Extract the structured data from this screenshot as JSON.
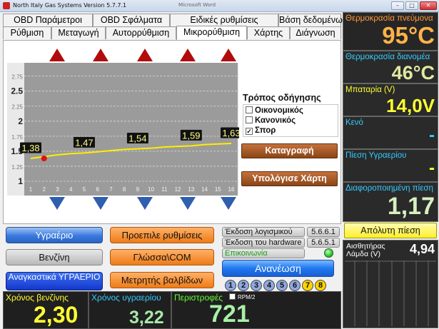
{
  "titlebar": {
    "title": "North Italy Gas Systems    Version    5.7.7.1",
    "inner_title": "Microsoft Word",
    "minimize": "–",
    "maximize": "□",
    "close": "✕"
  },
  "tabs_row1": [
    {
      "label": "OBD Παράμετροι"
    },
    {
      "label": "OBD Σφάλματα"
    },
    {
      "label": "Ειδικές ρυθμίσεις"
    },
    {
      "label": "Βάση δεδομένων"
    }
  ],
  "tabs_row2": [
    {
      "label": "Ρύθμιση"
    },
    {
      "label": "Μεταγωγή"
    },
    {
      "label": "Αυτορρύθμιση"
    },
    {
      "label": "Μικρορύθμιση"
    },
    {
      "label": "Χάρτης"
    },
    {
      "label": "Διάγνωση"
    }
  ],
  "chart_data": {
    "type": "line",
    "x": [
      1,
      2,
      3,
      4,
      5,
      6,
      7,
      8,
      9,
      10,
      11,
      12,
      13,
      14,
      15,
      16
    ],
    "y_ticks": [
      "2.75",
      "2.5",
      "2.25",
      "2",
      "1.75",
      "1.5",
      "1.25",
      "1"
    ],
    "ylim": [
      1,
      2.9
    ],
    "series": [
      {
        "values": [
          1.38,
          1.41,
          1.44,
          1.46,
          1.47,
          1.49,
          1.51,
          1.53,
          1.54,
          1.55,
          1.57,
          1.58,
          1.59,
          1.61,
          1.62,
          1.63
        ]
      }
    ],
    "data_labels": [
      {
        "x": 1,
        "text": "1,38"
      },
      {
        "x": 5,
        "text": "1,47"
      },
      {
        "x": 9,
        "text": "1,54"
      },
      {
        "x": 13,
        "text": "1,59"
      },
      {
        "x": 16,
        "text": "1,63"
      }
    ],
    "marker": {
      "x": 2,
      "y": 1.38
    },
    "line_color": "#ffee00",
    "grid": true
  },
  "drive_mode": {
    "legend": "Τρόπος οδήγησης",
    "options": [
      {
        "label": "Οικονομικός",
        "checked": false
      },
      {
        "label": "Κανονικός",
        "checked": false
      },
      {
        "label": "Σπορ",
        "checked": true
      }
    ]
  },
  "buttons": {
    "record": "Καταγραφή",
    "calc_map": "Υπολόγισε Χάρτη",
    "lpg": "Υγραέριο",
    "petrol": "Βενζίνη",
    "forced_lpg": "Αναγκαστικά ΥΓΡΑΕΡΙΟ",
    "preset": "Προεπιλε ρυθμίσεις",
    "language_com": "Γλώσσα\\COM",
    "valve_counter": "Μετρητής βαλβίδων",
    "refresh": "Ανανέωση"
  },
  "info": {
    "software_label": "Έκδοση λογισμικού",
    "software_value": "5.6.6.1",
    "hardware_label": "Έκδοση του hardware",
    "hardware_value": "5.6.5.1",
    "comm_label": "Επικοινωνία",
    "comm_color": "#33cc33"
  },
  "cylinders": [
    "1",
    "2",
    "3",
    "4",
    "5",
    "6",
    "7",
    "8"
  ],
  "counters": {
    "petrol_time_label": "Χρόνος βενζίνης",
    "petrol_time": "2,30",
    "lpg_time_label": "Χρόνος υγραερίου",
    "lpg_time": "3,22",
    "rpm_label": "Περιστροφές",
    "rpm_check": "RPM/2",
    "rpm": "721"
  },
  "right": {
    "gas_temp_label": "Θερμοκρασία πνεύμονα",
    "gas_temp": "95°C",
    "reducer_temp_label": "Θερμοκρασία διανομέα",
    "reducer_temp": "46°C",
    "battery_label": "Μπαταρία (V)",
    "battery": "14,0V",
    "vacuum_label": "Κενό",
    "vacuum": "-",
    "lpg_pressure_label": "Πίεση Υγραερίου",
    "lpg_pressure": "-",
    "diff_pressure_label": "Διαφοροποιημένη πίεση",
    "diff_pressure": "1,17",
    "absolute_pressure_btn": "Απόλυτη πίεση",
    "lambda_label": "Αισθητήρας Λάμδα (V)",
    "lambda": "4,94"
  }
}
